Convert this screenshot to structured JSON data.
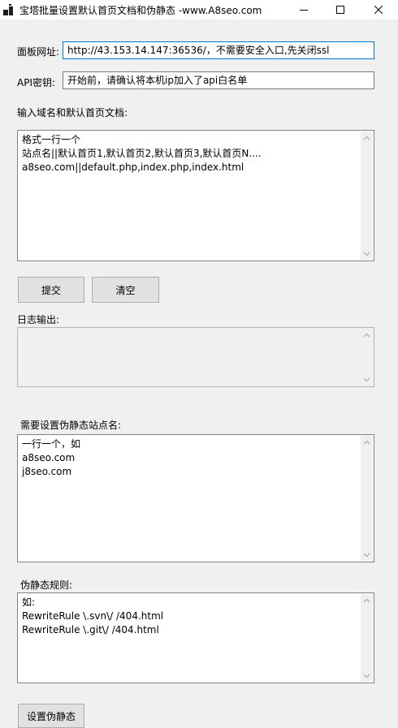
{
  "window": {
    "title": "宝塔批量设置默认首页文档和伪静态 -www.A8seo.com"
  },
  "panel_url": {
    "label": "面板网址:",
    "value": "http://43.153.14.147:36536/，不需要安全入口,先关闭ssl"
  },
  "api_key": {
    "label": "API密钥:",
    "value": "开始前，请确认将本机ip加入了api白名单"
  },
  "domains": {
    "label": "输入域名和默认首页文档:",
    "lines": [
      "格式一行一个",
      "站点名||默认首页1,默认首页2,默认首页3,默认首页N....",
      "a8seo.com||default.php,index.php,index.html"
    ]
  },
  "buttons": {
    "submit": "提交",
    "clear": "清空",
    "set_rewrite": "设置伪静态"
  },
  "log": {
    "label": "日志输出:"
  },
  "rewrite_sites": {
    "label": "需要设置伪静态站点名:",
    "lines": [
      "一行一个，如",
      "a8seo.com",
      "j8seo.com"
    ]
  },
  "rewrite_rules": {
    "label": "伪静态规则:",
    "lines": [
      "如:",
      "RewriteRule \\.svn\\/ /404.html",
      "RewriteRule \\.git\\/ /404.html"
    ]
  },
  "icons": {
    "app": "app-icon",
    "minimize": "minimize-icon",
    "maximize": "maximize-icon",
    "close": "close-icon",
    "scroll_up": "chevron-up-icon",
    "scroll_down": "chevron-down-icon"
  },
  "colors": {
    "focus_border": "#0078d7",
    "window_bg": "#f0f0f0"
  }
}
